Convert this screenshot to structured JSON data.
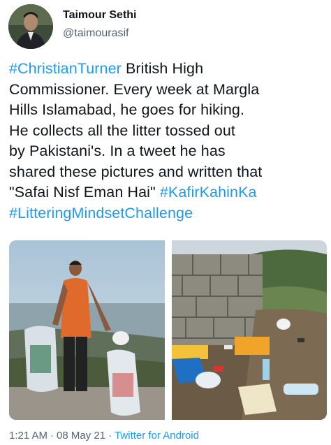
{
  "author": {
    "name": "Taimour Sethi",
    "handle": "@taimourasif"
  },
  "tweet": {
    "tag1": "#ChristianTurner",
    "body": " British High\nCommissioner. Every week at Margla\nHills Islamabad, he goes for hiking.\nHe collects all the litter tossed out\nby Pakistani's. In a tweet he has\nshared these pictures and written that\n\"Safai Nisf Eman Hai\" ",
    "tag2": "#KafirKahinKa",
    "tag3": "#LitteringMindsetChallenge"
  },
  "meta": {
    "time": "1:21 AM",
    "date": "08 May 21",
    "separator": "·",
    "source": "Twitter for Android"
  },
  "colors": {
    "link": "#1d9bf0",
    "secondary_text": "#536471"
  }
}
